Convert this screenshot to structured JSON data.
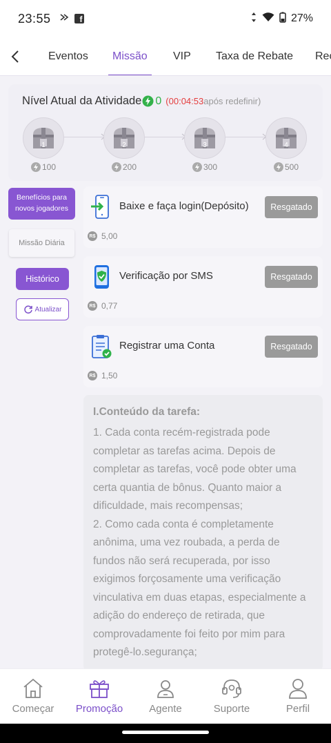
{
  "status_bar": {
    "time": "23:55",
    "battery": "27%"
  },
  "tabs": [
    "Eventos",
    "Missão",
    "VIP",
    "Taxa de Rebate",
    "Rec"
  ],
  "activity": {
    "title": "Nível Atual da Atividade",
    "level": "0",
    "timer_open": "(",
    "timer": "00:04:53",
    "timer_suffix": "após redefinir)",
    "chests": [
      {
        "number": "1",
        "points": "100"
      },
      {
        "number": "2",
        "points": "200"
      },
      {
        "number": "3",
        "points": "300"
      },
      {
        "number": "4",
        "points": "500"
      }
    ]
  },
  "sidebar": {
    "beneficios": "Benefícios para novos jogadores",
    "missao_diaria": "Missão Diária",
    "historico": "Histórico",
    "atualizar": "Atualizar"
  },
  "tasks": [
    {
      "title": "Baixe e faça login(Depósito)",
      "button": "Resgatado",
      "reward": "5,00",
      "icon": "phone-login-icon"
    },
    {
      "title": "Verificação por SMS",
      "button": "Resgatado",
      "reward": "0,77",
      "icon": "phone-shield-icon"
    },
    {
      "title": "Registrar uma Conta",
      "button": "Resgatado",
      "reward": "1,50",
      "icon": "clipboard-check-icon"
    }
  ],
  "currency_badge": "R$",
  "content": {
    "heading": "I.Conteúdo da tarefa:",
    "p1": "1. Cada conta recém-registrada pode completar as tarefas acima. Depois de completar as tarefas, você pode obter uma certa quantia de bônus. Quanto maior a dificuldade, mais recompensas;",
    "p2": "2. Como cada conta é completamente anônima, uma vez roubada, a perda de fundos não será recuperada, por isso exigimos forçosamente uma verificação vinculativa em duas etapas, especialmente a adição do endereço de retirada, que comprovadamente foi feito por mim para protegê-lo.segurança;"
  },
  "bottom_nav": [
    "Começar",
    "Promoção",
    "Agente",
    "Suporte",
    "Perfil"
  ],
  "colors": {
    "accent": "#7b4fc9",
    "button_purple": "#8856d2",
    "level_green": "#33b14a",
    "timer_red": "#e43e3e",
    "claimed_gray": "#9a9a9a"
  }
}
